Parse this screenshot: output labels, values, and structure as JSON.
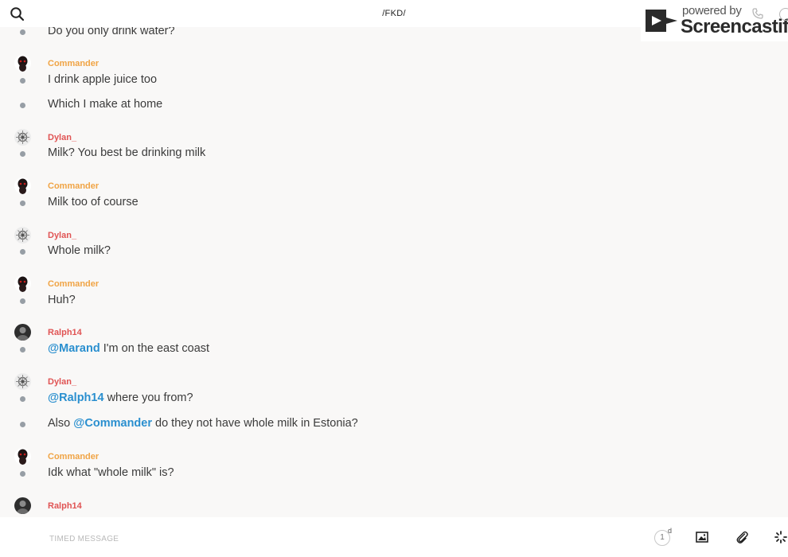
{
  "header": {
    "channel_title": "/FKD/",
    "search_icon": "search-icon"
  },
  "watermark": {
    "powered_by": "powered by",
    "brand": "Screencastify"
  },
  "users": {
    "commander": {
      "name": "Commander",
      "color": "#f0a445"
    },
    "dylan": {
      "name": "Dylan_",
      "color": "#e05454"
    },
    "ralph": {
      "name": "Ralph14",
      "color": "#e05454"
    }
  },
  "messages": {
    "m0": "Do you only drink water?",
    "m1": "I drink apple juice too",
    "m2": "Which I make at home",
    "m3": "Milk? You best be drinking milk",
    "m4": "Milk too of course",
    "m5": "Whole milk?",
    "m6": "Huh?",
    "m7_mention": "@Marand",
    "m7_text": " I'm on the east coast",
    "m8_mention": "@Ralph14",
    "m8_text": " where you from?",
    "m9_pre": "Also ",
    "m9_mention": "@Commander",
    "m9_text": " do they not have whole milk in Estonia?",
    "m10": "Idk what \"whole milk\" is?"
  },
  "composer": {
    "placeholder": "TIMED MESSAGE",
    "timer_value": "1",
    "timer_unit": "d",
    "icons": [
      "image-icon",
      "attachment-icon",
      "loading-icon"
    ]
  }
}
